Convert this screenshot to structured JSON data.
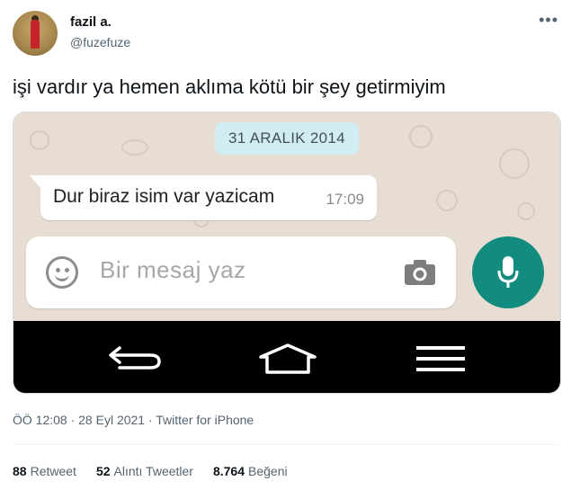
{
  "author": {
    "name": "fazil a.",
    "handle": "@fuzefuze"
  },
  "more_icon": "more-horizontal-icon",
  "tweet_text": "işi vardır ya hemen aklıma kötü bir şey getirmiyim",
  "media": {
    "date_label": "31 ARALIK 2014",
    "message": {
      "text": "Dur biraz isim var yazicam",
      "time": "17:09"
    },
    "input_placeholder": "Bir mesaj yaz",
    "icons": {
      "emoji": "emoji-icon",
      "camera": "camera-icon",
      "mic": "mic-icon",
      "back": "back-icon",
      "home": "home-icon",
      "menu": "menu-icon"
    },
    "colors": {
      "chat_background": "#e7ddd2",
      "date_pill": "#d2ecf4",
      "mic_button": "#128c7e",
      "navbar": "#000000"
    }
  },
  "meta": "ÖÖ 12:08 · 28 Eyl 2021 · Twitter for iPhone",
  "stats": {
    "retweets": {
      "count": "88",
      "label": "Retweet"
    },
    "quotes": {
      "count": "52",
      "label": "Alıntı Tweetler"
    },
    "likes": {
      "count": "8.764",
      "label": "Beğeni"
    }
  }
}
